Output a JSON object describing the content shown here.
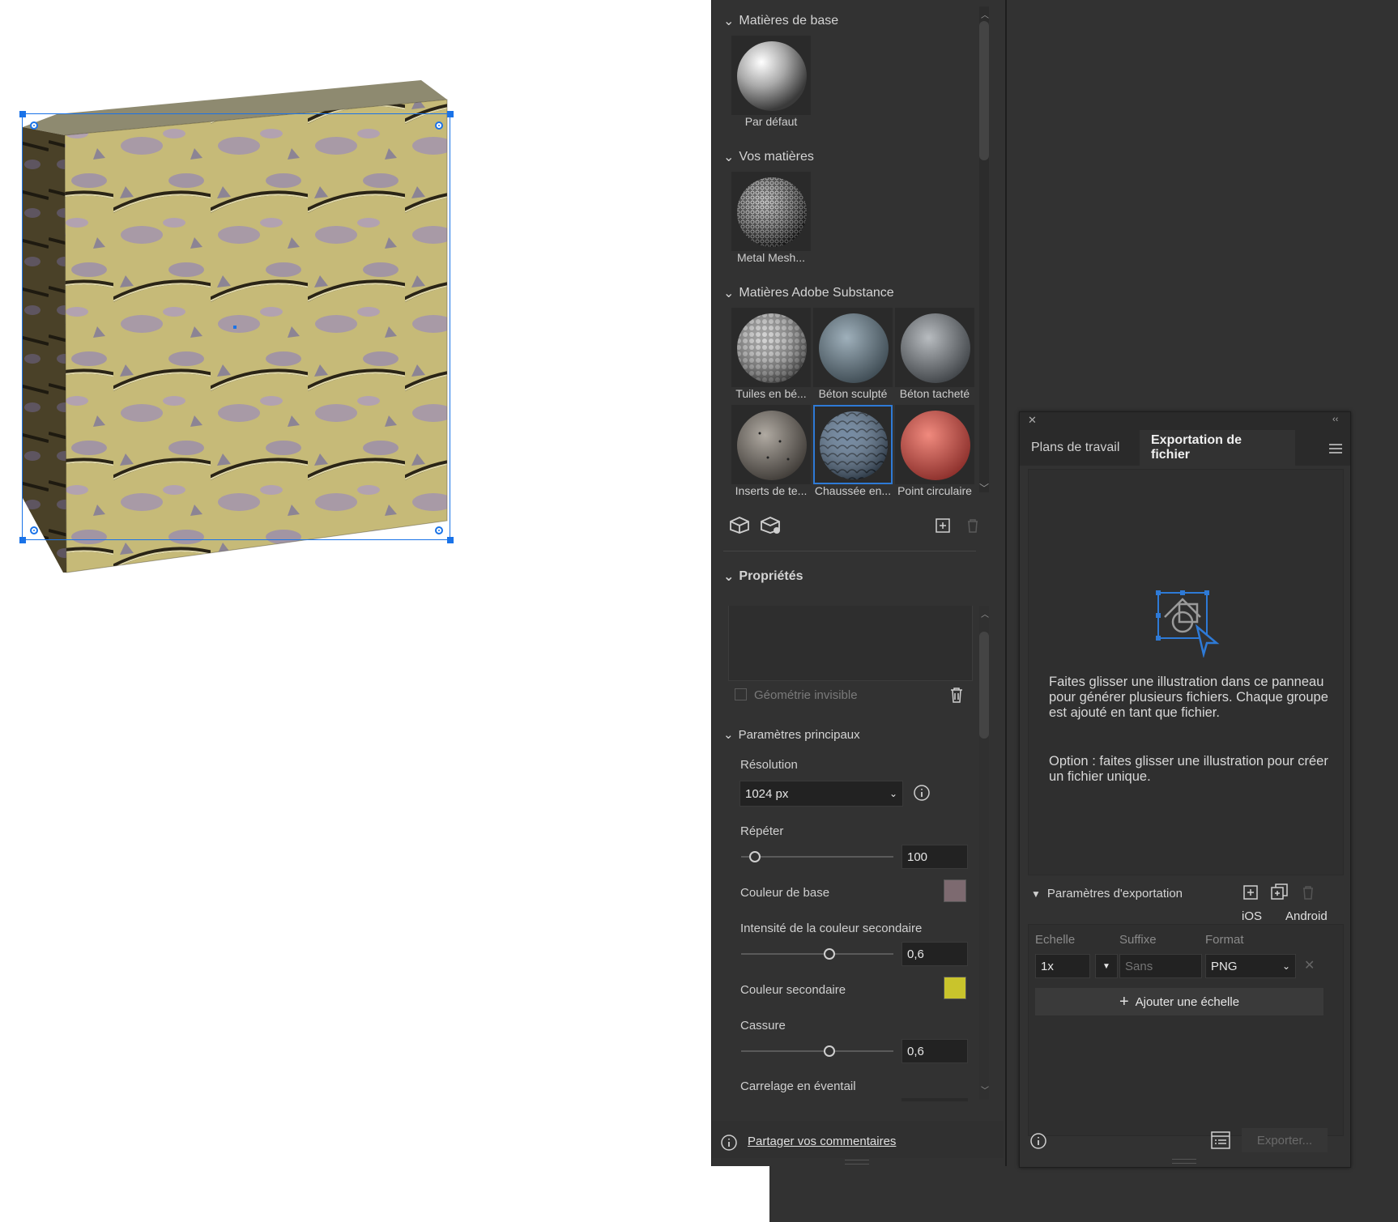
{
  "materials_panel": {
    "sections": {
      "base": "Matières de base",
      "yours": "Vos matières",
      "substance": "Matières Adobe Substance",
      "properties": "Propriétés",
      "main_params": "Paramètres principaux"
    },
    "base_materials": [
      {
        "label": "Par défaut",
        "icon": "default-sphere"
      }
    ],
    "your_materials": [
      {
        "label": "Metal Mesh...",
        "icon": "metal-mesh-sphere"
      }
    ],
    "substance_materials": [
      {
        "label": "Tuiles en bé...",
        "icon": "concrete-tiles-sphere",
        "selected": false
      },
      {
        "label": "Béton sculpté",
        "icon": "sculpted-concrete-sphere",
        "selected": false
      },
      {
        "label": "Béton tacheté",
        "icon": "speckled-concrete-sphere",
        "selected": false
      },
      {
        "label": "Inserts de te...",
        "icon": "terrazzo-inserts-sphere",
        "selected": false
      },
      {
        "label": "Chaussée en...",
        "icon": "pavement-sphere",
        "selected": true
      },
      {
        "label": "Point circulaire",
        "icon": "circular-dot-sphere",
        "selected": false
      }
    ],
    "invisible_geometry": "Géométrie invisible",
    "params": {
      "resolution_label": "Résolution",
      "resolution_value": "1024 px",
      "repeat_label": "Répéter",
      "repeat_value": "100",
      "repeat_level": 0.04,
      "base_color_label": "Couleur de base",
      "base_color": "#7d6a70",
      "secondary_intensity_label": "Intensité de la couleur secondaire",
      "secondary_intensity_value": "0,6",
      "secondary_intensity_level": 0.6,
      "secondary_color_label": "Couleur secondaire",
      "secondary_color": "#c9c42c",
      "break_label": "Cassure",
      "break_value": "0,6",
      "break_level": 0.6,
      "fan_tiling_label": "Carrelage en éventail"
    },
    "feedback_link": "Partager vos commentaires"
  },
  "export_panel": {
    "tabs": [
      "Plans de travail",
      "Exportation de fichier"
    ],
    "active_tab": "Exportation de fichier",
    "info_main": "Faites glisser une illustration dans ce panneau pour générer plusieurs fichiers. Chaque groupe est ajouté en tant que fichier.",
    "info_option": "Option : faites glisser une illustration pour créer un fichier unique.",
    "export_settings_label": "Paramètres d'exportation",
    "platforms": [
      "iOS",
      "Android"
    ],
    "columns": {
      "scale": "Echelle",
      "suffix": "Suffixe",
      "format": "Format"
    },
    "row": {
      "scale": "1x",
      "suffix_placeholder": "Sans",
      "format": "PNG"
    },
    "add_scale": "Ajouter une échelle",
    "export_button": "Exporter..."
  },
  "colors": {
    "panel_bg": "#323232",
    "accent": "#2e7ad6",
    "selection": "#1a73e8"
  }
}
